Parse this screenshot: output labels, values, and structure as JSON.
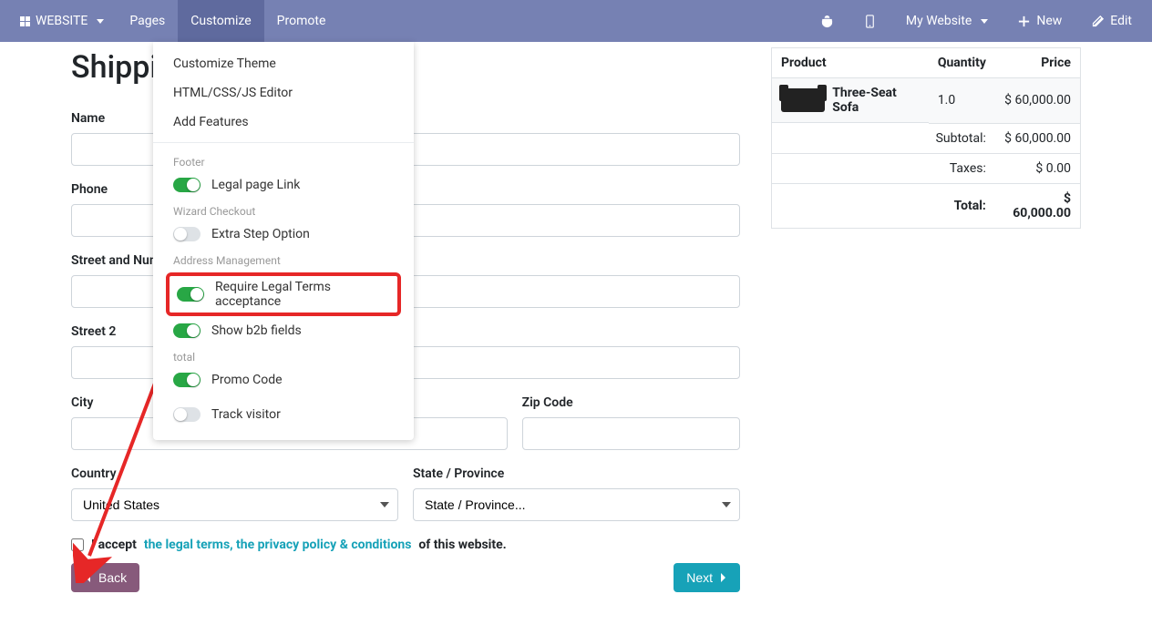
{
  "topbar": {
    "website": "WEBSITE",
    "pages": "Pages",
    "customize": "Customize",
    "promote": "Promote",
    "my_website": "My Website",
    "new": "New",
    "edit": "Edit"
  },
  "page": {
    "title": "Shippin"
  },
  "form": {
    "name_label": "Name",
    "phone_label": "Phone",
    "street_label": "Street and Number",
    "street2_label": "Street 2",
    "city_label": "City",
    "zip_label": "Zip Code",
    "country_label": "Country",
    "country_value": "United States",
    "state_label": "State / Province",
    "state_placeholder": "State / Province...",
    "accept_prefix": "I accept",
    "accept_link": "the legal terms, the privacy policy & conditions",
    "accept_suffix": "of this website.",
    "back": "Back",
    "next": "Next"
  },
  "dropdown": {
    "customize_theme": "Customize Theme",
    "html_editor": "HTML/CSS/JS Editor",
    "add_features": "Add Features",
    "section_footer": "Footer",
    "legal_page_link": "Legal page Link",
    "section_wizard": "Wizard Checkout",
    "extra_step": "Extra Step Option",
    "section_address": "Address Management",
    "require_legal": "Require Legal Terms acceptance",
    "show_b2b": "Show b2b fields",
    "section_total": "total",
    "promo_code": "Promo Code",
    "track_visitor": "Track visitor"
  },
  "order": {
    "col_product": "Product",
    "col_qty": "Quantity",
    "col_price": "Price",
    "product_name": "Three-Seat Sofa",
    "product_qty": "1.0",
    "product_price": "$ 60,000.00",
    "subtotal_label": "Subtotal:",
    "subtotal_value": "$ 60,000.00",
    "taxes_label": "Taxes:",
    "taxes_value": "$ 0.00",
    "total_label": "Total:",
    "total_value": "$ 60,000.00"
  }
}
